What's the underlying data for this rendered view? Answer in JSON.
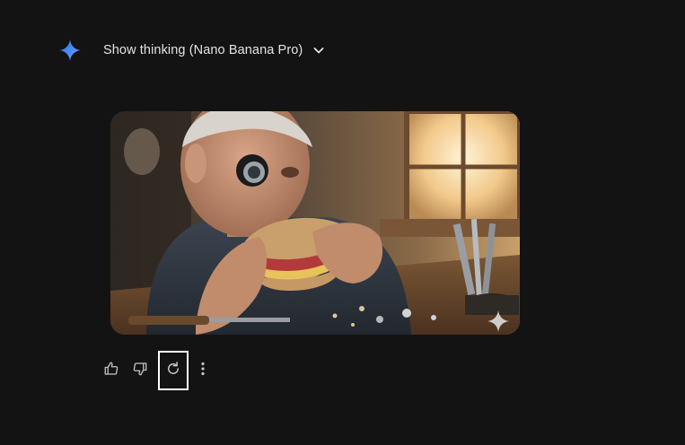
{
  "response": {
    "thinking_toggle": {
      "label": "Show thinking (Nano Banana Pro)",
      "icon": "chevron-down-icon"
    },
    "model_icon": "gemini-spark-icon",
    "image": {
      "alt": "Elderly man with a jeweler's loupe eating a sandwich at a watchmaker's workbench",
      "watermark_icon": "sparkle-watermark-icon"
    },
    "actions": [
      {
        "name": "thumbs-up",
        "icon": "thumbs-up-icon"
      },
      {
        "name": "thumbs-down",
        "icon": "thumbs-down-icon"
      },
      {
        "name": "regenerate",
        "icon": "refresh-icon"
      },
      {
        "name": "more-options",
        "icon": "more-vert-icon"
      }
    ]
  },
  "colors": {
    "background": "#131314",
    "text": "#e3e3e3",
    "spark_blue": "#4285f4",
    "icon_gray": "#c4c7c5",
    "focus_outline": "#ffffff"
  }
}
